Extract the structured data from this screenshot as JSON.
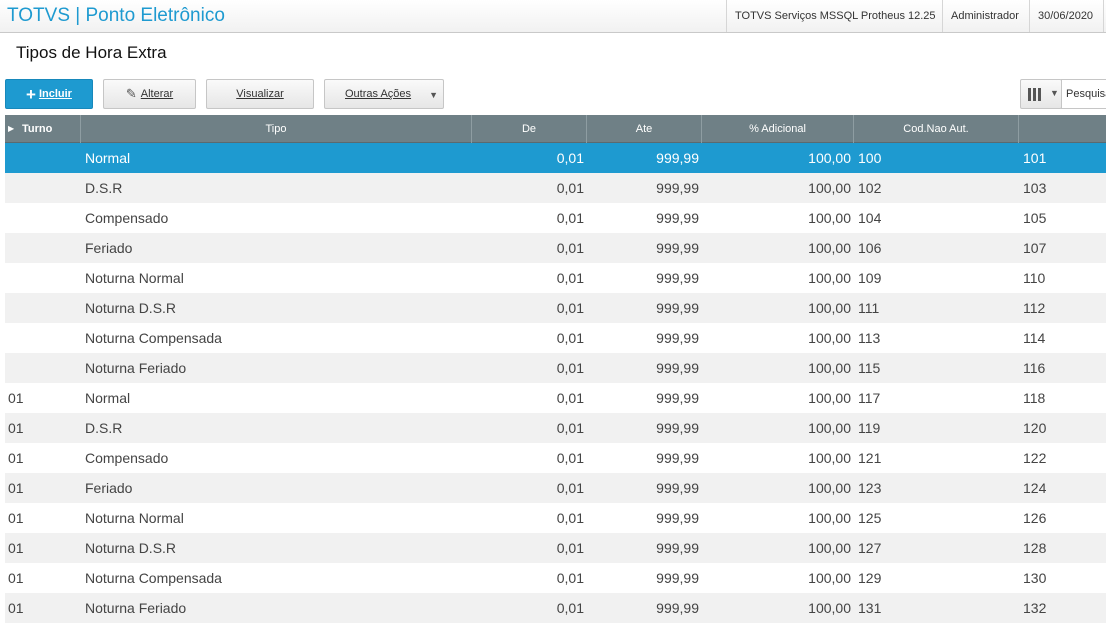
{
  "topbar": {
    "app_title": "TOTVS | Ponto Eletrônico",
    "environment": "TOTVS Serviços MSSQL Protheus 12.25",
    "user": "Administrador",
    "date": "30/06/2020"
  },
  "page_title": "Tipos de Hora Extra",
  "toolbar": {
    "incluir_label": "Incluir",
    "alterar_label": "Alterar",
    "visualizar_label": "Visualizar",
    "outras_acoes_label": "Outras Ações",
    "search_placeholder": "Pesquisar"
  },
  "icons": {
    "incluir": "plus-icon",
    "alterar": "pencil-icon",
    "outras_acoes": "caret-down-icon",
    "columns": "columns-icon"
  },
  "colors": {
    "accent": "#1e9ad0",
    "header_bg": "#6f8086",
    "row_alt": "#f1f1f1"
  },
  "grid": {
    "columns": {
      "turno": "Turno",
      "tipo": "Tipo",
      "de": "De",
      "ate": "Ate",
      "adicional": "% Adicional",
      "cod_nao_aut": "Cod.Nao Aut.",
      "cod_aut": ""
    },
    "rows": [
      {
        "turno": "",
        "tipo": "Normal",
        "de": "0,01",
        "ate": "999,99",
        "adicional": "100,00",
        "cod_nao_aut": "100",
        "cod_aut": "101"
      },
      {
        "turno": "",
        "tipo": "D.S.R",
        "de": "0,01",
        "ate": "999,99",
        "adicional": "100,00",
        "cod_nao_aut": "102",
        "cod_aut": "103"
      },
      {
        "turno": "",
        "tipo": "Compensado",
        "de": "0,01",
        "ate": "999,99",
        "adicional": "100,00",
        "cod_nao_aut": "104",
        "cod_aut": "105"
      },
      {
        "turno": "",
        "tipo": "Feriado",
        "de": "0,01",
        "ate": "999,99",
        "adicional": "100,00",
        "cod_nao_aut": "106",
        "cod_aut": "107"
      },
      {
        "turno": "",
        "tipo": "Noturna Normal",
        "de": "0,01",
        "ate": "999,99",
        "adicional": "100,00",
        "cod_nao_aut": "109",
        "cod_aut": "110"
      },
      {
        "turno": "",
        "tipo": "Noturna D.S.R",
        "de": "0,01",
        "ate": "999,99",
        "adicional": "100,00",
        "cod_nao_aut": "111",
        "cod_aut": "112"
      },
      {
        "turno": "",
        "tipo": "Noturna Compensada",
        "de": "0,01",
        "ate": "999,99",
        "adicional": "100,00",
        "cod_nao_aut": "113",
        "cod_aut": "114"
      },
      {
        "turno": "",
        "tipo": "Noturna Feriado",
        "de": "0,01",
        "ate": "999,99",
        "adicional": "100,00",
        "cod_nao_aut": "115",
        "cod_aut": "116"
      },
      {
        "turno": "01",
        "tipo": "Normal",
        "de": "0,01",
        "ate": "999,99",
        "adicional": "100,00",
        "cod_nao_aut": "117",
        "cod_aut": "118"
      },
      {
        "turno": "01",
        "tipo": "D.S.R",
        "de": "0,01",
        "ate": "999,99",
        "adicional": "100,00",
        "cod_nao_aut": "119",
        "cod_aut": "120"
      },
      {
        "turno": "01",
        "tipo": "Compensado",
        "de": "0,01",
        "ate": "999,99",
        "adicional": "100,00",
        "cod_nao_aut": "121",
        "cod_aut": "122"
      },
      {
        "turno": "01",
        "tipo": "Feriado",
        "de": "0,01",
        "ate": "999,99",
        "adicional": "100,00",
        "cod_nao_aut": "123",
        "cod_aut": "124"
      },
      {
        "turno": "01",
        "tipo": "Noturna Normal",
        "de": "0,01",
        "ate": "999,99",
        "adicional": "100,00",
        "cod_nao_aut": "125",
        "cod_aut": "126"
      },
      {
        "turno": "01",
        "tipo": "Noturna D.S.R",
        "de": "0,01",
        "ate": "999,99",
        "adicional": "100,00",
        "cod_nao_aut": "127",
        "cod_aut": "128"
      },
      {
        "turno": "01",
        "tipo": "Noturna Compensada",
        "de": "0,01",
        "ate": "999,99",
        "adicional": "100,00",
        "cod_nao_aut": "129",
        "cod_aut": "130"
      },
      {
        "turno": "01",
        "tipo": "Noturna Feriado",
        "de": "0,01",
        "ate": "999,99",
        "adicional": "100,00",
        "cod_nao_aut": "131",
        "cod_aut": "132"
      }
    ],
    "selected_row": 0
  }
}
